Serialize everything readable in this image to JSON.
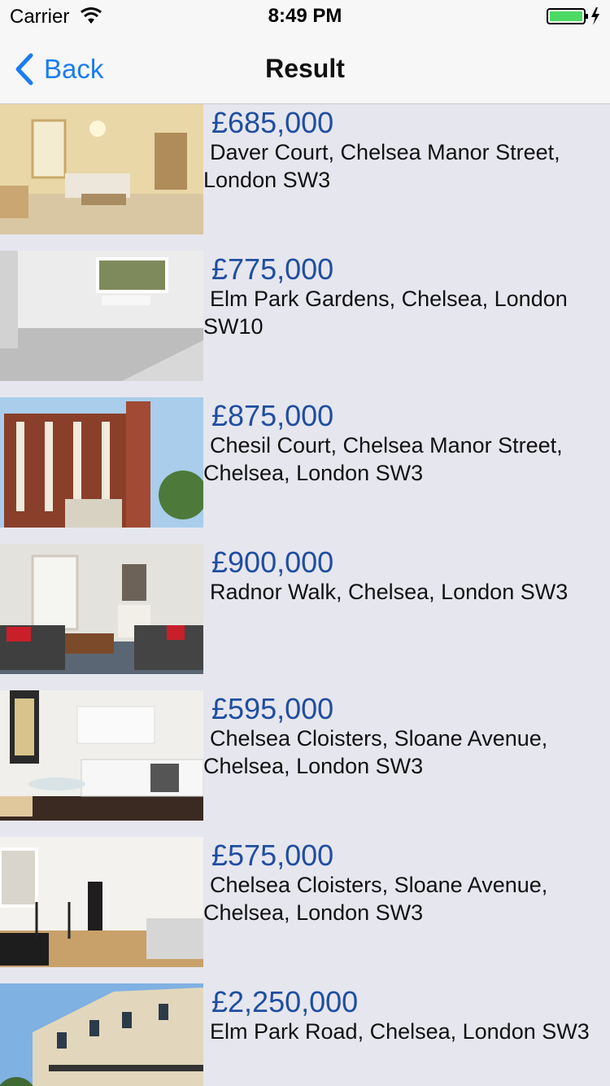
{
  "status_bar": {
    "carrier": "Carrier",
    "time": "8:49 PM",
    "battery_color": "#4cd964"
  },
  "nav": {
    "back_label": "Back",
    "title": "Result",
    "accent_color": "#1a7cf5"
  },
  "listings": [
    {
      "price": "£685,000",
      "address": "Daver Court, Chelsea Manor Street, London SW3",
      "image": "living-room-photo"
    },
    {
      "price": "£775,000",
      "address": "Elm Park Gardens, Chelsea, London SW10",
      "image": "empty-room-photo"
    },
    {
      "price": "£875,000",
      "address": "Chesil Court, Chelsea Manor Street, Chelsea, London SW3",
      "image": "building-exterior-photo"
    },
    {
      "price": "£900,000",
      "address": "Radnor Walk, Chelsea, London SW3",
      "image": "lounge-photo"
    },
    {
      "price": "£595,000",
      "address": "Chelsea Cloisters, Sloane Avenue, Chelsea, London SW3",
      "image": "kitchen-photo"
    },
    {
      "price": "£575,000",
      "address": "Chelsea Cloisters, Sloane Avenue, Chelsea, London SW3",
      "image": "studio-photo"
    },
    {
      "price": "£2,250,000",
      "address": "Elm Park Road, Chelsea, London SW3",
      "image": "terrace-exterior-photo"
    }
  ]
}
